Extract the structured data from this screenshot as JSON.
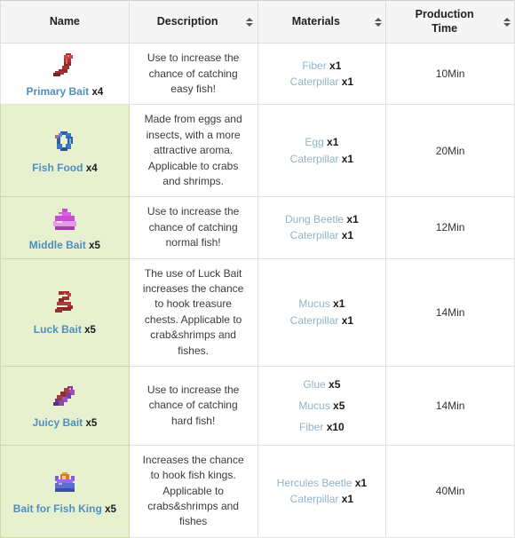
{
  "table": {
    "columns": [
      {
        "label": "Name",
        "sortable": false,
        "sort_icon": "sort-updown-icon"
      },
      {
        "label": "Description",
        "sortable": true,
        "sort_icon": "sort-updown-icon"
      },
      {
        "label": "Materials",
        "sortable": true,
        "sort_icon": "sort-updown-icon"
      },
      {
        "label": "Production Time",
        "sortable": true,
        "sort_icon": "sort-updown-icon"
      }
    ],
    "column_labels": {
      "name": "Name",
      "description": "Description",
      "materials": "Materials",
      "production_time_line1": "Production",
      "production_time_line2": "Time"
    },
    "rows": [
      {
        "name": "Primary Bait",
        "quantity": "x4",
        "icon": "worm-red-icon",
        "name_tinted": false,
        "description": "Use to increase the chance of catching easy fish!",
        "materials": [
          {
            "name": "Fiber",
            "qty": "x1"
          },
          {
            "name": "Caterpillar",
            "qty": "x1"
          }
        ],
        "production_time": "10Min"
      },
      {
        "name": "Fish Food",
        "quantity": "x4",
        "icon": "leech-blue-icon",
        "name_tinted": true,
        "description": "Made from eggs and insects, with a more attractive aroma. Applicable to crabs and shrimps.",
        "materials": [
          {
            "name": "Egg",
            "qty": "x1"
          },
          {
            "name": "Caterpillar",
            "qty": "x1"
          }
        ],
        "production_time": "20Min"
      },
      {
        "name": "Middle Bait",
        "quantity": "x5",
        "icon": "bait-magenta-icon",
        "name_tinted": true,
        "description": "Use to increase the chance of catching normal fish!",
        "materials": [
          {
            "name": "Dung Beetle",
            "qty": "x1"
          },
          {
            "name": "Caterpillar",
            "qty": "x1"
          }
        ],
        "production_time": "12Min"
      },
      {
        "name": "Luck Bait",
        "quantity": "x5",
        "icon": "worm-coiled-icon",
        "name_tinted": true,
        "description": "The use of Luck Bait increases the chance to hook treasure chests. Applicable to crab&shrimps and fishes.",
        "materials": [
          {
            "name": "Mucus",
            "qty": "x1"
          },
          {
            "name": "Caterpillar",
            "qty": "x1"
          }
        ],
        "production_time": "14Min"
      },
      {
        "name": "Juicy Bait",
        "quantity": "x5",
        "icon": "crystal-cluster-icon",
        "name_tinted": true,
        "description": "Use to increase the chance of catching hard fish!",
        "materials": [
          {
            "name": "Glue",
            "qty": "x5"
          },
          {
            "name": "Mucus",
            "qty": "x5"
          },
          {
            "name": "Fiber",
            "qty": "x10"
          }
        ],
        "production_time": "14Min"
      },
      {
        "name": "Bait for Fish King",
        "quantity": "x5",
        "icon": "crown-icon",
        "name_tinted": true,
        "description": "Increases the chance to hook fish kings. Applicable to crabs&shrimps and fishes",
        "materials": [
          {
            "name": "Hercules Beetle",
            "qty": "x1"
          },
          {
            "name": "Caterpillar",
            "qty": "x1"
          }
        ],
        "production_time": "40Min"
      }
    ]
  },
  "colors": {
    "header_bg": "#f5f5f5",
    "name_tint_bg": "#e7f0cf",
    "link_blue": "#4f8fbf",
    "material_link": "#8fb3cc",
    "border": "#e2e2e2"
  }
}
